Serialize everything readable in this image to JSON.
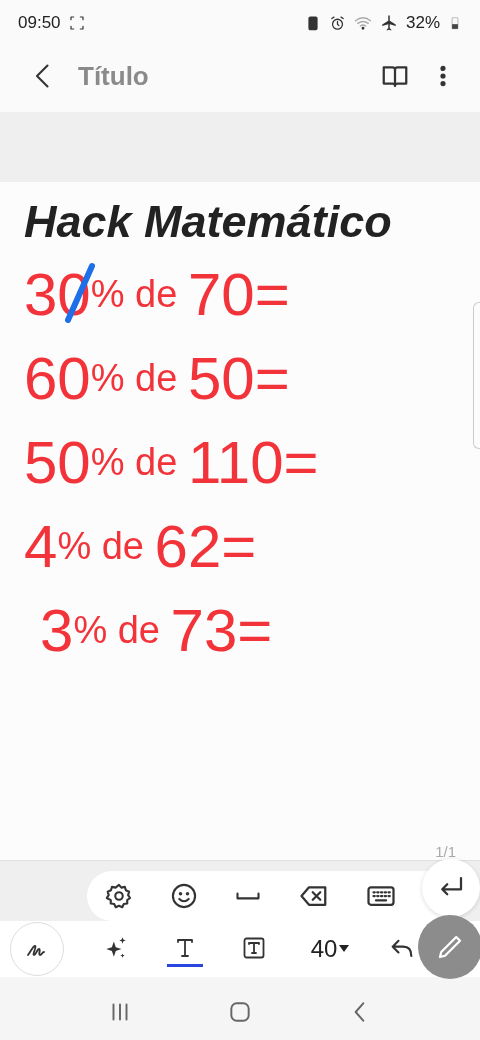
{
  "status_bar": {
    "time": "09:50",
    "battery": "32%"
  },
  "header": {
    "title": "Título"
  },
  "note": {
    "heading": "Hack Matemático",
    "lines": [
      {
        "parts": [
          "30",
          "% de",
          "70="
        ],
        "indented": false,
        "struck": true
      },
      {
        "parts": [
          "60",
          "% de",
          "50="
        ],
        "indented": false,
        "struck": false
      },
      {
        "parts": [
          "50",
          "% de",
          "110="
        ],
        "indented": false,
        "struck": false
      },
      {
        "parts": [
          "4",
          "% de",
          "62="
        ],
        "indented": false,
        "struck": false
      },
      {
        "parts": [
          "3",
          "% de",
          "73="
        ],
        "indented": true,
        "struck": false
      }
    ],
    "page_indicator": "1/1"
  },
  "keyboard_bar": {
    "keys": [
      {
        "kind": "settings"
      },
      {
        "kind": "emoji"
      },
      {
        "kind": "space"
      },
      {
        "kind": "backspace"
      },
      {
        "kind": "keyboard"
      },
      {
        "kind": "enter"
      }
    ]
  },
  "tool_bar": {
    "tools": [
      {
        "kind": "handwriting",
        "selected": false
      },
      {
        "kind": "sparkle",
        "selected": false
      },
      {
        "kind": "text",
        "selected": true
      },
      {
        "kind": "textbox",
        "selected": false
      }
    ],
    "font_size": "40"
  }
}
